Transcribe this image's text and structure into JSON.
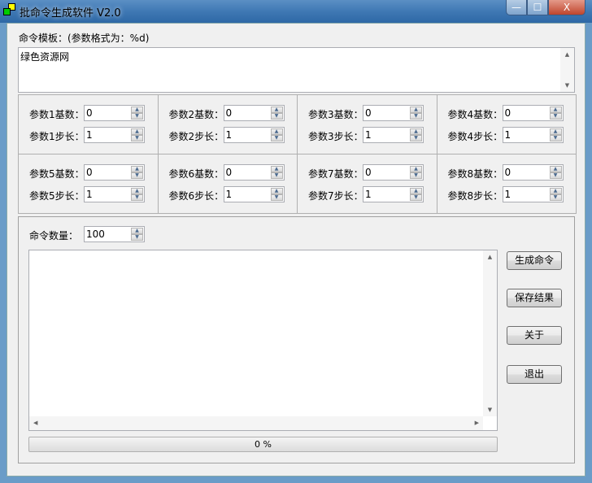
{
  "window": {
    "title": "批命令生成软件 V2.0",
    "minimize": "—",
    "maximize": "☐",
    "close": "X"
  },
  "template": {
    "label": "命令模板：(参数格式为：%d)",
    "value": "绿色资源网"
  },
  "params": [
    {
      "base_label": "参数1基数：",
      "base": "0",
      "step_label": "参数1步长：",
      "step": "1"
    },
    {
      "base_label": "参数2基数：",
      "base": "0",
      "step_label": "参数2步长：",
      "step": "1"
    },
    {
      "base_label": "参数3基数：",
      "base": "0",
      "step_label": "参数3步长：",
      "step": "1"
    },
    {
      "base_label": "参数4基数：",
      "base": "0",
      "step_label": "参数4步长：",
      "step": "1"
    },
    {
      "base_label": "参数5基数：",
      "base": "0",
      "step_label": "参数5步长：",
      "step": "1"
    },
    {
      "base_label": "参数6基数：",
      "base": "0",
      "step_label": "参数6步长：",
      "step": "1"
    },
    {
      "base_label": "参数7基数：",
      "base": "0",
      "step_label": "参数7步长：",
      "step": "1"
    },
    {
      "base_label": "参数8基数：",
      "base": "0",
      "step_label": "参数8步长：",
      "step": "1"
    }
  ],
  "count": {
    "label": "命令数量：",
    "value": "100"
  },
  "output": {
    "value": ""
  },
  "progress": {
    "text": "0 %",
    "percent": 0
  },
  "buttons": {
    "generate": "生成命令",
    "save": "保存结果",
    "about": "关于",
    "exit": "退出"
  }
}
